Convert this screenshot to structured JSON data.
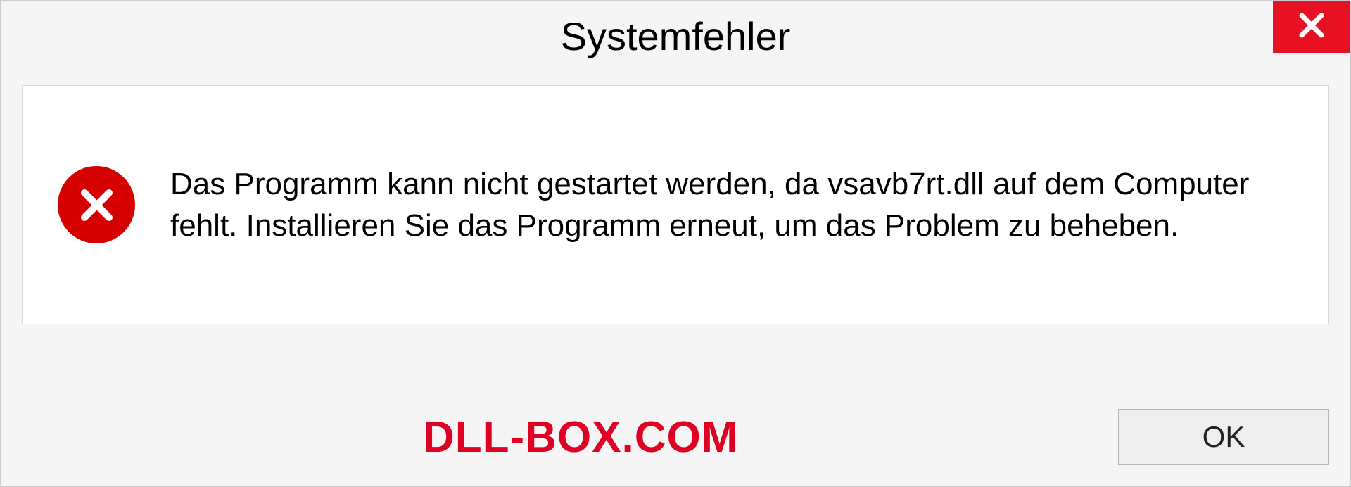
{
  "dialog": {
    "title": "Systemfehler",
    "message": "Das Programm kann nicht gestartet werden, da vsavb7rt.dll auf dem Computer fehlt. Installieren Sie das Programm erneut, um das Problem zu beheben.",
    "ok_label": "OK"
  },
  "watermark": "DLL-BOX.COM"
}
